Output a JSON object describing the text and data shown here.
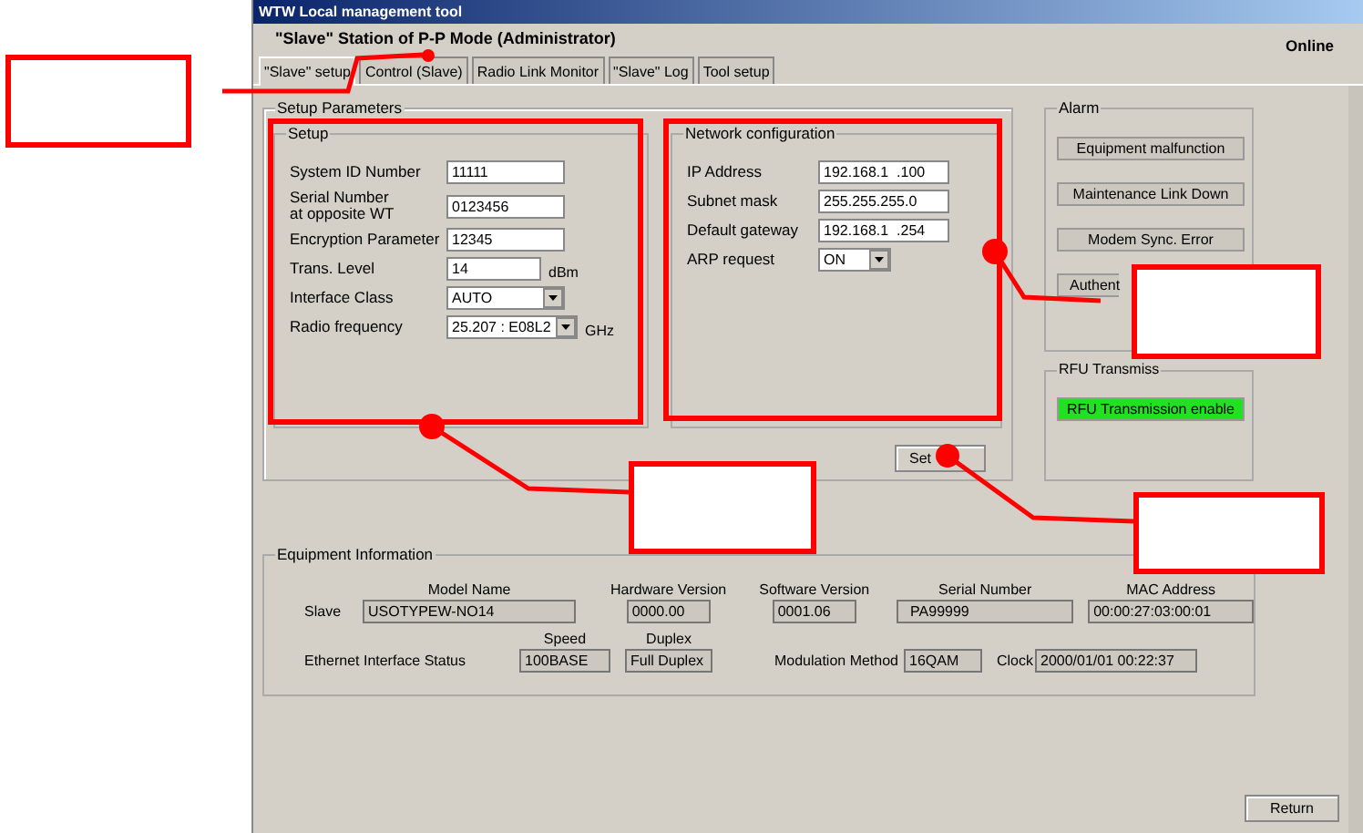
{
  "window": {
    "title": "WTW Local management tool"
  },
  "header": {
    "title": "\"Slave\" Station of P-P Mode (Administrator)",
    "status": "Online"
  },
  "tabs": [
    {
      "label": "\"Slave\" setup",
      "selected": true
    },
    {
      "label": "Control (Slave)",
      "selected": false
    },
    {
      "label": "Radio Link Monitor",
      "selected": false
    },
    {
      "label": "\"Slave\" Log",
      "selected": false
    },
    {
      "label": "Tool setup",
      "selected": false
    }
  ],
  "setup_parameters": {
    "title": "Setup Parameters",
    "setup": {
      "title": "Setup",
      "fields": [
        {
          "kind": "input",
          "label": "System ID Number",
          "value": "11111"
        },
        {
          "kind": "input",
          "label": "Serial Number\nat opposite WT",
          "value": "0123456"
        },
        {
          "kind": "input",
          "label": "Encryption Parameter",
          "value": "12345"
        },
        {
          "kind": "input",
          "label": "Trans. Level",
          "value": "14",
          "unit": "dBm"
        },
        {
          "kind": "select",
          "label": "Interface Class",
          "value": "AUTO"
        },
        {
          "kind": "select",
          "label": "Radio frequency",
          "value": "25.207 : E08L2",
          "unit": "GHz"
        }
      ]
    },
    "network": {
      "title": "Network configuration",
      "fields": [
        {
          "kind": "input",
          "label": "IP Address",
          "value": "192.168.1  .100"
        },
        {
          "kind": "input",
          "label": "Subnet mask",
          "value": "255.255.255.0"
        },
        {
          "kind": "input",
          "label": "Default gateway",
          "value": "192.168.1  .254"
        },
        {
          "kind": "select",
          "label": "ARP request",
          "value": "ON"
        }
      ]
    },
    "set_button": "Set"
  },
  "alarm": {
    "title": "Alarm",
    "buttons": [
      "Equipment malfunction",
      "Maintenance Link Down",
      "Modem Sync. Error",
      "Authent"
    ]
  },
  "rfu": {
    "title": "RFU Transmiss",
    "button": "RFU Transmission enable",
    "enabled": true
  },
  "equipment_information": {
    "title": "Equipment Information",
    "row_1": {
      "label": "Slave",
      "fields": [
        {
          "header": "Model Name",
          "value": "USOTYPEW-NO14"
        },
        {
          "header": "Hardware Version",
          "value": "0000.00"
        },
        {
          "header": "Software Version",
          "value": "0001.06"
        },
        {
          "header": "Serial Number",
          "value": "  PA99999"
        },
        {
          "header": "MAC Address",
          "value": "00:00:27:03:00:01"
        }
      ]
    },
    "row_2": {
      "label": "Ethernet Interface Status",
      "fields": [
        {
          "header": "Speed",
          "value": "100BASE"
        },
        {
          "header": "Duplex",
          "value": "Full Duplex"
        },
        {
          "label": "Modulation Method",
          "value": "16QAM"
        },
        {
          "label": "Clock",
          "value": "2000/01/01 00:22:37"
        }
      ]
    }
  },
  "return_button": "Return"
}
